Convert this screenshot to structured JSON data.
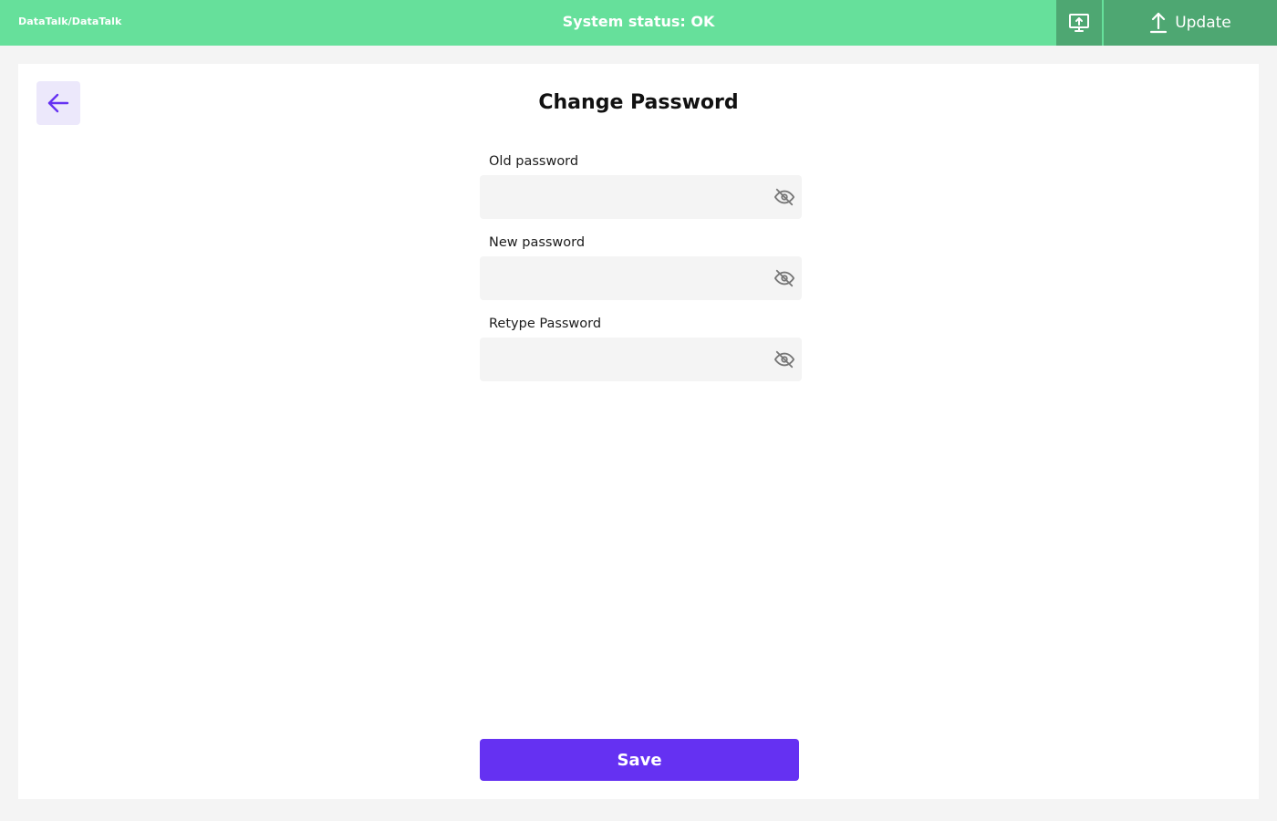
{
  "header": {
    "breadcrumb": "DataTalk/DataTalk",
    "status": "System status: OK",
    "screen_icon": "monitor-upload-icon",
    "update_icon": "upload-arrow-icon",
    "update_label": "Update",
    "colors": {
      "bar": "#66e09b",
      "button": "#4ea772"
    }
  },
  "page": {
    "back_icon": "arrow-left-icon",
    "title": "Change Password"
  },
  "form": {
    "old_password": {
      "label": "Old password",
      "value": "",
      "visibility_icon": "eye-off-icon"
    },
    "new_password": {
      "label": "New password",
      "value": "",
      "visibility_icon": "eye-off-icon"
    },
    "retype_password": {
      "label": "Retype Password",
      "value": "",
      "visibility_icon": "eye-off-icon"
    }
  },
  "actions": {
    "save_label": "Save",
    "accent": "#6531f2"
  }
}
